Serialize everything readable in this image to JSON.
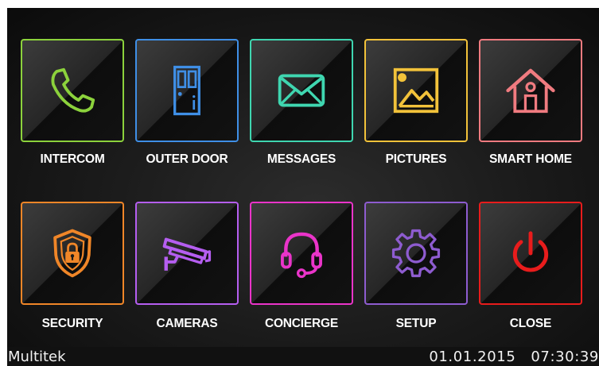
{
  "tiles": [
    {
      "label": "INTERCOM",
      "icon": "phone-icon",
      "color": "#8cd23c"
    },
    {
      "label": "OUTER DOOR",
      "icon": "door-icon",
      "color": "#3f8fe6"
    },
    {
      "label": "MESSAGES",
      "icon": "envelope-icon",
      "color": "#3fd6b0"
    },
    {
      "label": "PICTURES",
      "icon": "picture-icon",
      "color": "#f2c23a"
    },
    {
      "label": "SMART HOME",
      "icon": "house-icon",
      "color": "#f07b80"
    },
    {
      "label": "SECURITY",
      "icon": "shield-lock-icon",
      "color": "#f08628"
    },
    {
      "label": "CAMERAS",
      "icon": "security-camera-icon",
      "color": "#b55ef0"
    },
    {
      "label": "CONCIERGE",
      "icon": "headset-icon",
      "color": "#ea34c9"
    },
    {
      "label": "SETUP",
      "icon": "gear-icon",
      "color": "#8e5cd0"
    },
    {
      "label": "CLOSE",
      "icon": "power-icon",
      "color": "#e81c1c"
    }
  ],
  "status_bar": {
    "brand": "Multitek",
    "date": "01.01.2015",
    "time": "07:30:39"
  }
}
